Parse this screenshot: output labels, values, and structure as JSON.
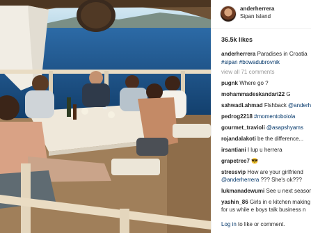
{
  "post": {
    "username": "anderherrera",
    "location": "Sipan Island",
    "likes": "36.5k likes",
    "caption_user": "anderherrera",
    "caption_text": "Paradises in Croatia",
    "caption_tags": "#sipan #bowadubrovnik",
    "view_all": "view all 71 comments",
    "footer_login": "Log in",
    "footer_rest": "to like or comment."
  },
  "comments": [
    {
      "user": "pugnk",
      "text": "Where go ?"
    },
    {
      "user": "mohammadeskandari22",
      "text": "G"
    },
    {
      "user": "sahwadi.ahmad",
      "text": "Flshback ",
      "mention": "@anderh"
    },
    {
      "user": "pedrog2218",
      "text": "",
      "mention": "#momentoboiola"
    },
    {
      "user": "gourmet_travioli",
      "text": "",
      "mention": "@asapshyams"
    },
    {
      "user": "rojandalakoti",
      "text": "be the difference..."
    },
    {
      "user": "irsantiani",
      "text": "I lup u herrera"
    },
    {
      "user": "grapetree7",
      "text": "😎"
    },
    {
      "user": "stressvip",
      "text": "How are your girlfriend",
      "line2_mention": "@anderherrera",
      "line2_text": " ??? She's ok???"
    },
    {
      "user": "lukmanadewumi",
      "text": "See u next season"
    },
    {
      "user": "yashin_86",
      "text": "Girls in e kitchen making",
      "line2_text": "for us while e boys talk business n"
    }
  ],
  "icons": {
    "avatar": "profile-avatar"
  }
}
